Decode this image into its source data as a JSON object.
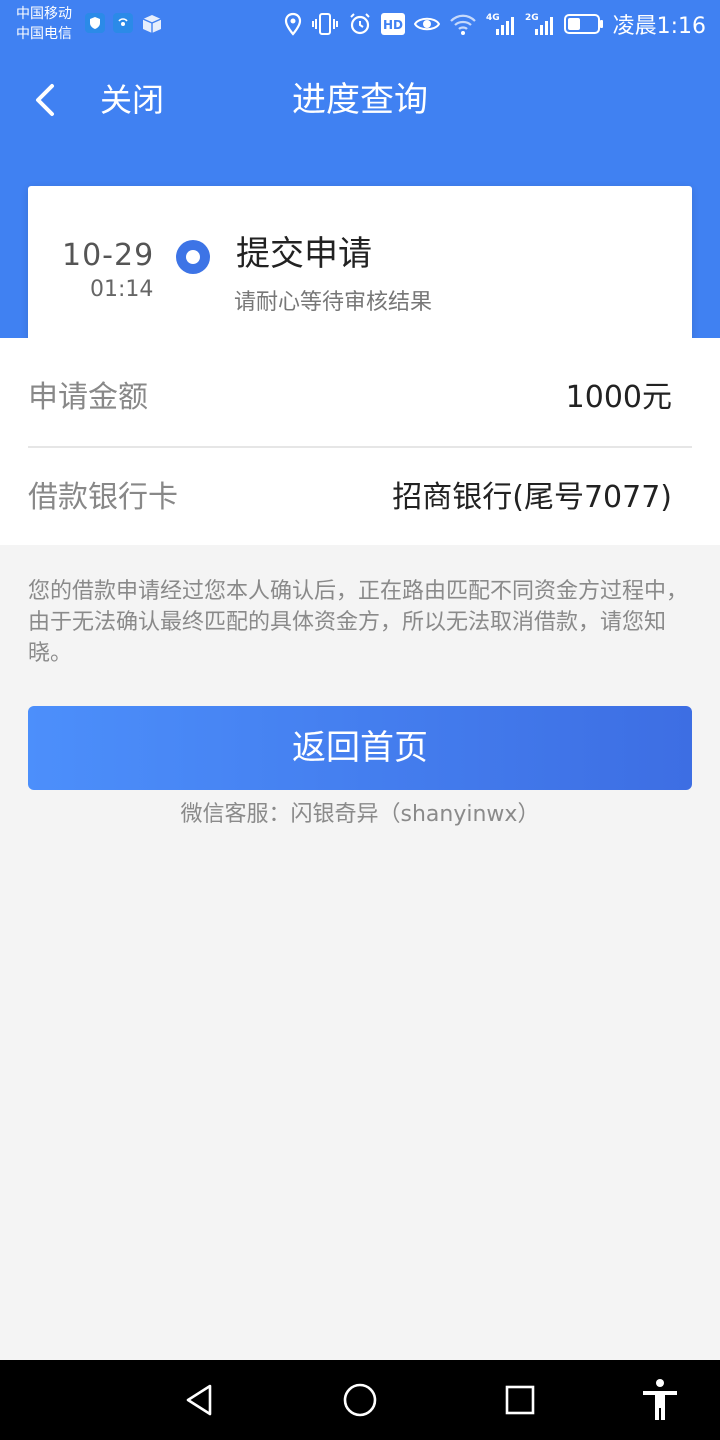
{
  "status_bar": {
    "carrier_1": "中国移动",
    "carrier_2": "中国电信",
    "network_4g": "4G",
    "network_2g": "2G",
    "hd": "HD",
    "time": "凌晨1:16"
  },
  "nav": {
    "close_label": "关闭",
    "title": "进度查询"
  },
  "progress": {
    "date": "10-29",
    "time": "01:14",
    "step_title": "提交申请",
    "step_subtitle": "请耐心等待审核结果"
  },
  "details": [
    {
      "label": "申请金额",
      "value": "1000元"
    },
    {
      "label": "借款银行卡",
      "value": "招商银行(尾号7077)"
    }
  ],
  "notice": "您的借款申请经过您本人确认后，正在路由匹配不同资金方过程中，由于无法确认最终匹配的具体资金方，所以无法取消借款，请您知晓。",
  "home_button_label": "返回首页",
  "service_text": "微信客服：闪银奇异（shanyinwx）",
  "colors": {
    "brand_blue": "#4081f2",
    "button_start": "#4c8ffb",
    "button_end": "#3d6ee3",
    "page_bg": "#f4f4f4"
  }
}
